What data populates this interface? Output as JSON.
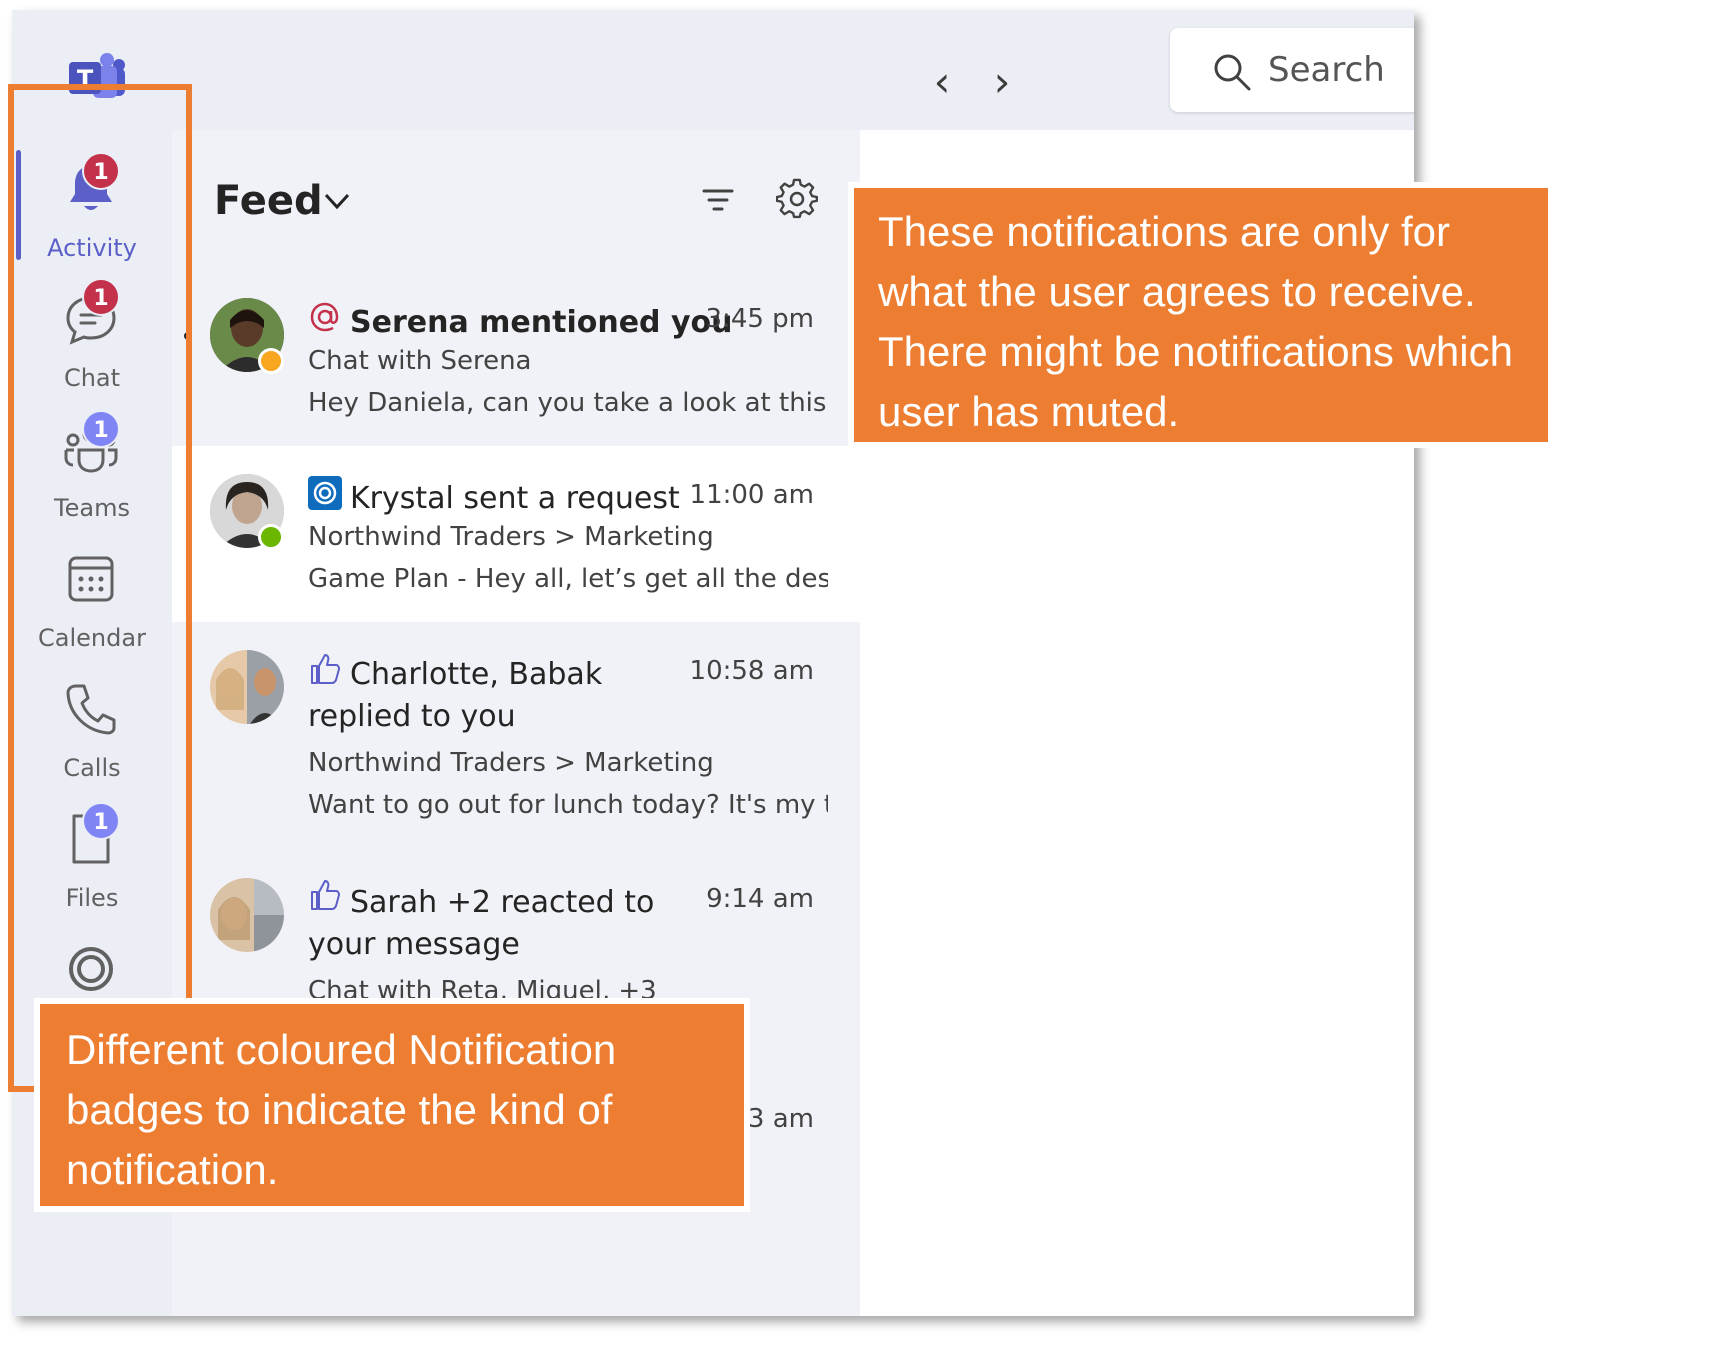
{
  "app": {
    "search_placeholder": "Search",
    "back_symbol": "‹",
    "forward_symbol": "›"
  },
  "rail": {
    "items": [
      {
        "label": "Activity",
        "icon": "bell-icon",
        "badge": "1",
        "badge_color": "#c4314b",
        "active": true
      },
      {
        "label": "Chat",
        "icon": "chat-icon",
        "badge": "1",
        "badge_color": "#c4314b"
      },
      {
        "label": "Teams",
        "icon": "teams-icon",
        "badge": "1",
        "badge_color": "#7f85f5"
      },
      {
        "label": "Calendar",
        "icon": "calendar-icon"
      },
      {
        "label": "Calls",
        "icon": "phone-icon"
      },
      {
        "label": "Files",
        "icon": "file-icon",
        "badge": "1",
        "badge_color": "#7f85f5"
      },
      {
        "label": "",
        "icon": "loop-icon"
      }
    ]
  },
  "feed": {
    "title": "Feed",
    "items": [
      {
        "title": "Serena mentioned you",
        "time": "3:45 pm",
        "subtitle": "Chat with Serena",
        "preview": "Hey Daniela, can you take a look at this - n...",
        "icon": "mention-icon",
        "status": "away",
        "unread": true
      },
      {
        "title": "Krystal sent a request",
        "time": "11:00 am",
        "subtitle": "Northwind Traders > Marketing",
        "preview": "Game Plan - Hey all, let’s get all the design...",
        "icon": "loop-request-icon",
        "status": "available",
        "selected": true
      },
      {
        "title": "Charlotte, Babak replied to you",
        "time": "10:58 am",
        "subtitle": "Northwind Traders > Marketing",
        "preview": "Want to go out for lunch today? It's my tre...",
        "icon": "thumbs-up-icon"
      },
      {
        "title": "Sarah +2 reacted to your message",
        "time": "9:14 am",
        "subtitle": "Chat with Reta, Miguel, +3",
        "icon": "thumbs-up-icon"
      },
      {
        "time": "3 am"
      }
    ]
  },
  "annotations": {
    "top": "These notifications are only for what the user agrees to receive. There might be notifications which user has muted.",
    "bottom": "Different coloured Notification badges to indicate the kind of notification.",
    "accent_color": "#ed7d31"
  },
  "colors": {
    "brand": "#5b5fc7",
    "badge_red": "#c4314b",
    "badge_purple": "#7f85f5",
    "available": "#6bb700",
    "away": "#f8a51f"
  }
}
